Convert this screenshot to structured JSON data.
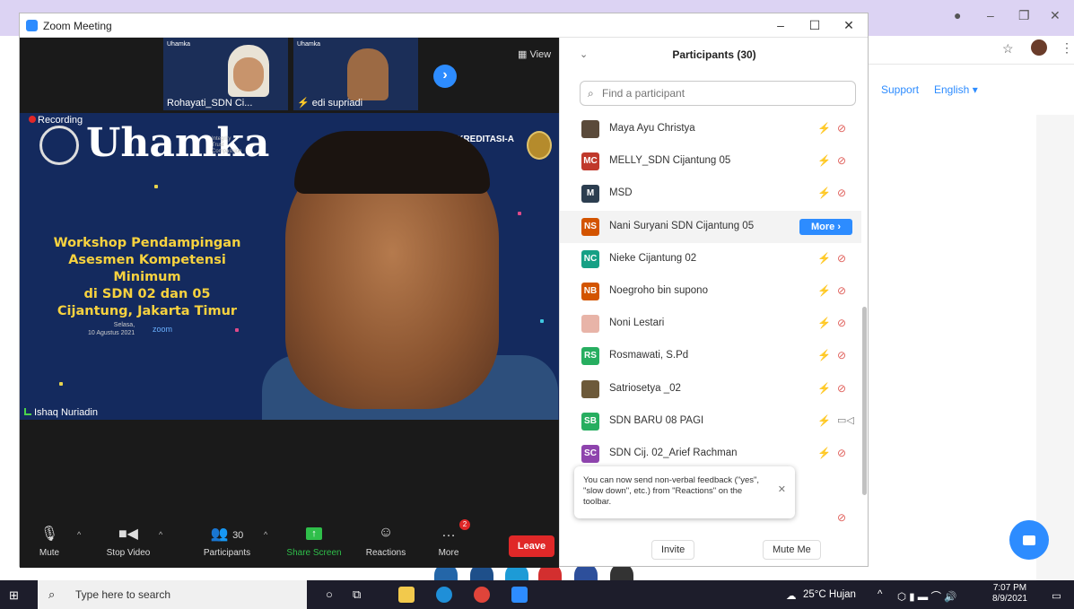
{
  "browser": {
    "nav_links": [
      "Support",
      "English ▾"
    ],
    "star_icon": "star-icon",
    "menu_icon": "kebab-icon"
  },
  "zoom": {
    "window_title": "Zoom Meeting",
    "view_label": "View",
    "thumbnails": [
      {
        "name": "Rohayati_SDN Ci..."
      },
      {
        "name": "edi supriadi"
      }
    ],
    "main_video": {
      "recording_label": "Recording",
      "brand": "Uhamka",
      "tagline": [
        "Integrity",
        "Trust",
        "Compassion"
      ],
      "accreditation": "TERAKREDITASI-A",
      "workshop_lines": [
        "Workshop Pendampingan",
        "Asesmen Kompetensi Minimum",
        "di SDN 02 dan 05",
        "Cijantung, Jakarta Timur"
      ],
      "date_lines": [
        "Selasa,",
        "10 Agustus 2021"
      ],
      "zoom_mark": "zoom",
      "speaker": "Ishaq Nuriadin"
    },
    "toolbar": {
      "mute": "Mute",
      "stop_video": "Stop Video",
      "participants": "Participants",
      "participants_count": "30",
      "share_screen": "Share Screen",
      "reactions": "Reactions",
      "more": "More",
      "more_badge": "2",
      "leave": "Leave"
    }
  },
  "panel": {
    "title": "Participants (30)",
    "search_placeholder": "Find a participant",
    "participants": [
      {
        "initials": "",
        "name": "Maya Ayu Christya",
        "color": "#5a4a3a",
        "photo": true
      },
      {
        "initials": "MC",
        "name": "MELLY_SDN Cijantung 05",
        "color": "#c0392b"
      },
      {
        "initials": "M",
        "name": "MSD",
        "color": "#2c3e50"
      },
      {
        "initials": "NS",
        "name": "Nani Suryani SDN Cijantung 05",
        "color": "#d35400",
        "more": "More ›"
      },
      {
        "initials": "NC",
        "name": "Nieke Cijantung 02",
        "color": "#16a085"
      },
      {
        "initials": "NB",
        "name": "Noegroho bin supono",
        "color": "#d35400"
      },
      {
        "initials": "",
        "name": "Noni Lestari",
        "color": "#e8b4a8",
        "photo": true
      },
      {
        "initials": "RS",
        "name": "Rosmawati, S.Pd",
        "color": "#27ae60"
      },
      {
        "initials": "",
        "name": "Satriosetya _02",
        "color": "#6d5a3a",
        "photo": true
      },
      {
        "initials": "SB",
        "name": "SDN BARU 08 PAGI",
        "color": "#27ae60",
        "cam_on": true
      },
      {
        "initials": "SC",
        "name": "SDN Cij. 02_Arief Rachman",
        "color": "#8e44ad"
      }
    ],
    "tooltip": "You can now send non-verbal feedback (\"yes\", \"slow down\", etc.) from \"Reactions\" on the toolbar.",
    "invite": "Invite",
    "mute_me": "Mute Me"
  },
  "taskbar": {
    "search_placeholder": "Type here to search",
    "weather": "25°C Hujan",
    "time": "7:07 PM",
    "date": "8/9/2021"
  }
}
